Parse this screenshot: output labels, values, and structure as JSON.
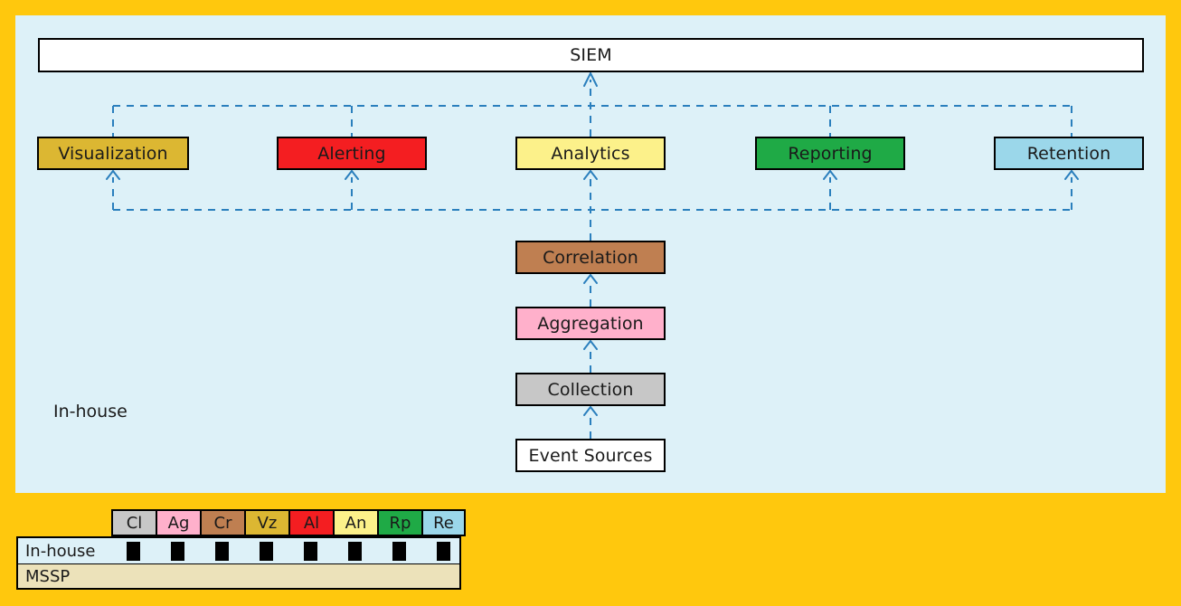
{
  "canvas": {
    "background_color": "#ffc80d",
    "panel_color": "#ddf1f8"
  },
  "diagram": {
    "title_box": {
      "label": "SIEM",
      "fill": "#ffffff"
    },
    "panel_caption": "In-house",
    "tier_capabilities": [
      {
        "id": "visualization",
        "label": "Visualization",
        "fill": "#dcb732"
      },
      {
        "id": "alerting",
        "label": "Alerting",
        "fill": "#f41e21"
      },
      {
        "id": "analytics",
        "label": "Analytics",
        "fill": "#fcf18a"
      },
      {
        "id": "reporting",
        "label": "Reporting",
        "fill": "#1faa46"
      },
      {
        "id": "retention",
        "label": "Retention",
        "fill": "#9bd7ea"
      }
    ],
    "pipeline": [
      {
        "id": "correlation",
        "label": "Correlation",
        "fill": "#bf7f51"
      },
      {
        "id": "aggregation",
        "label": "Aggregation",
        "fill": "#ffb0cb"
      },
      {
        "id": "collection",
        "label": "Collection",
        "fill": "#c7c7c7"
      },
      {
        "id": "event-sources",
        "label": "Event Sources",
        "fill": "#ffffff"
      }
    ],
    "connector_color": "#2a7fbd",
    "connector_style": "dashed"
  },
  "legend": {
    "columns": [
      {
        "abbr": "Cl",
        "fill": "#c7c7c7"
      },
      {
        "abbr": "Ag",
        "fill": "#ffb0cb"
      },
      {
        "abbr": "Cr",
        "fill": "#bf7f51"
      },
      {
        "abbr": "Vz",
        "fill": "#dcb732"
      },
      {
        "abbr": "Al",
        "fill": "#f41e21"
      },
      {
        "abbr": "An",
        "fill": "#fcf18a"
      },
      {
        "abbr": "Rp",
        "fill": "#1faa46"
      },
      {
        "abbr": "Re",
        "fill": "#9bd7ea"
      }
    ],
    "rows": [
      {
        "id": "in-house",
        "label": "In-house",
        "fill": "#ddf1f8",
        "marks": [
          true,
          true,
          true,
          true,
          true,
          true,
          true,
          true
        ]
      },
      {
        "id": "mssp",
        "label": "MSSP",
        "fill": "#ece2ba",
        "marks": [
          false,
          false,
          false,
          false,
          false,
          false,
          false,
          false
        ]
      }
    ]
  }
}
